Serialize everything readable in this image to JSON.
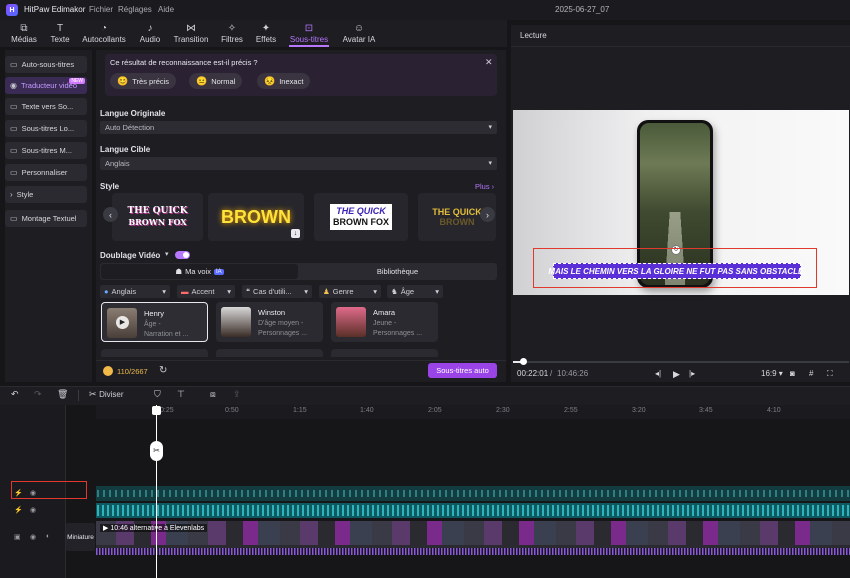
{
  "app": {
    "title": "HitPaw Edimakor",
    "date_title": "2025-06-27_07"
  },
  "menu": [
    "Fichier",
    "Réglages",
    "Aide"
  ],
  "tabs": [
    {
      "label": "Médias",
      "icon": "media-icon"
    },
    {
      "label": "Texte",
      "icon": "text-icon"
    },
    {
      "label": "Autocollants",
      "icon": "sticker-icon"
    },
    {
      "label": "Audio",
      "icon": "music-icon"
    },
    {
      "label": "Transition",
      "icon": "transition-icon"
    },
    {
      "label": "Filtres",
      "icon": "filter-icon"
    },
    {
      "label": "Effets",
      "icon": "effects-icon"
    },
    {
      "label": "Sous-titres",
      "icon": "subtitles-icon",
      "active": true
    },
    {
      "label": "Avatar IA",
      "icon": "avatar-icon"
    }
  ],
  "sidebar": {
    "items": [
      {
        "label": "Auto-sous-titres"
      },
      {
        "label": "Traducteur vidéo",
        "active": true,
        "badge": "NEW"
      },
      {
        "label": "Texte vers So..."
      },
      {
        "label": "Sous-titres Lo..."
      },
      {
        "label": "Sous-titres M..."
      },
      {
        "label": "Personnaliser"
      },
      {
        "label": "Style"
      },
      {
        "label": "Montage Textuel"
      }
    ]
  },
  "notice": {
    "question": "Ce résultat de reconnaissance est-il précis ?",
    "options": [
      "Très précis",
      "Normal",
      "Inexact"
    ]
  },
  "form": {
    "original_label": "Langue Originale",
    "original_value": "Auto Détection",
    "target_label": "Langue Cible",
    "target_value": "Anglais",
    "style_label": "Style",
    "more": "Plus",
    "styles": [
      {
        "line1": "THE QUICK",
        "line2": "BROWN FOX"
      },
      {
        "line1": "BROWN"
      },
      {
        "line1": "THE QUICK",
        "line2": "BROWN FOX"
      },
      {
        "line1": "THE QUICK",
        "line2": "BROWN"
      }
    ],
    "dub_label": "Doublage Vidéo",
    "voice_tab": "Ma voix",
    "voice_badge": "IA",
    "library_tab": "Bibliothèque",
    "filters": [
      "Anglais",
      "Accent",
      "Cas d'utili...",
      "Genre",
      "Âge"
    ]
  },
  "voices": [
    {
      "name": "Henry",
      "l1": "Âge -",
      "l2": "Narration et ..."
    },
    {
      "name": "Winston",
      "l1": "D'âge moyen -",
      "l2": "Personnages ..."
    },
    {
      "name": "Amara",
      "l1": "Jeune -",
      "l2": "Personnages ..."
    }
  ],
  "credits": {
    "value": "110/2667"
  },
  "auto_button": "Sous-titres auto",
  "preview": {
    "title": "Lecture",
    "caption": "MAIS LE CHEMIN VERS LA GLOIRE NE FUT PAS SANS OBSTACLE.",
    "time_current": "00:22:01",
    "time_total": "10:46:26",
    "aspect": "16:9",
    "progress": 0.03
  },
  "toolbar": {
    "split": "Diviser"
  },
  "ruler": [
    "0:25",
    "0:50",
    "1:15",
    "1:40",
    "2:05",
    "2:30",
    "2:55",
    "3:20",
    "3:45",
    "4:10"
  ],
  "timeline": {
    "clip_label": "10:46 alternative à Elevenlabs",
    "thumb_label": "Miniature"
  },
  "colors": {
    "accent": "#b777ff",
    "highlight": "#e03a2e"
  }
}
